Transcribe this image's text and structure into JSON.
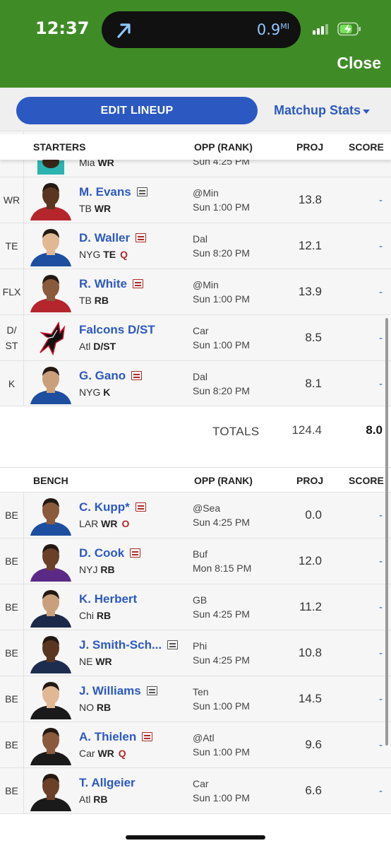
{
  "status_bar": {
    "time": "12:37",
    "distance": "0.9",
    "distance_unit": "MI"
  },
  "header": {
    "close_label": "Close"
  },
  "toolbar": {
    "edit_lineup_label": "EDIT LINEUP",
    "matchup_label": "Matchup Stats"
  },
  "columns": {
    "opp": "OPP (RANK)",
    "proj": "PROJ",
    "score": "SCORE"
  },
  "starters": {
    "title": "STARTERS",
    "partial_row": {
      "team": "Mia",
      "pos": "WR",
      "opp2": "Sun 4:25 PM"
    },
    "rows": [
      {
        "slot": "WR",
        "name": "M. Evans",
        "team": "TB",
        "pos": "WR",
        "status": "",
        "news": "gray",
        "opp": "@Min",
        "time": "Sun 1:00 PM",
        "proj": "13.8",
        "score": "-",
        "avatar": "player-buccaneers"
      },
      {
        "slot": "TE",
        "name": "D. Waller",
        "team": "NYG",
        "pos": "TE",
        "status": "Q",
        "news": "red",
        "opp": "Dal",
        "time": "Sun 8:20 PM",
        "proj": "12.1",
        "score": "-",
        "avatar": "player-giants"
      },
      {
        "slot": "FLX",
        "name": "R. White",
        "team": "TB",
        "pos": "RB",
        "status": "",
        "news": "red",
        "opp": "@Min",
        "time": "Sun 1:00 PM",
        "proj": "13.9",
        "score": "-",
        "avatar": "player-buccaneers"
      },
      {
        "slot": "D/\nST",
        "name": "Falcons D/ST",
        "team": "Atl",
        "pos": "D/ST",
        "status": "",
        "news": "",
        "opp": "Car",
        "time": "Sun 1:00 PM",
        "proj": "8.5",
        "score": "-",
        "avatar": "falcons-logo"
      },
      {
        "slot": "K",
        "name": "G. Gano",
        "team": "NYG",
        "pos": "K",
        "status": "",
        "news": "red",
        "opp": "Dal",
        "time": "Sun 8:20 PM",
        "proj": "8.1",
        "score": "-",
        "avatar": "player-giants"
      }
    ],
    "totals": {
      "label": "TOTALS",
      "proj": "124.4",
      "score": "8.0"
    }
  },
  "bench": {
    "title": "BENCH",
    "rows": [
      {
        "slot": "BE",
        "name": "C. Kupp*",
        "team": "LAR",
        "pos": "WR",
        "status": "O",
        "news": "red",
        "opp": "@Sea",
        "time": "Sun 4:25 PM",
        "proj": "0.0",
        "score": "-",
        "avatar": "player-rams"
      },
      {
        "slot": "BE",
        "name": "D. Cook",
        "team": "NYJ",
        "pos": "RB",
        "status": "",
        "news": "red",
        "opp": "Buf",
        "time": "Mon 8:15 PM",
        "proj": "12.0",
        "score": "-",
        "avatar": "player-vikings"
      },
      {
        "slot": "BE",
        "name": "K. Herbert",
        "team": "Chi",
        "pos": "RB",
        "status": "",
        "news": "",
        "opp": "GB",
        "time": "Sun 4:25 PM",
        "proj": "11.2",
        "score": "-",
        "avatar": "player-bears"
      },
      {
        "slot": "BE",
        "name": "J. Smith-Sch...",
        "team": "NE",
        "pos": "WR",
        "status": "",
        "news": "gray",
        "opp": "Phi",
        "time": "Sun 4:25 PM",
        "proj": "10.8",
        "score": "-",
        "avatar": "player-patriots"
      },
      {
        "slot": "BE",
        "name": "J. Williams",
        "team": "NO",
        "pos": "RB",
        "status": "",
        "news": "gray",
        "opp": "Ten",
        "time": "Sun 1:00 PM",
        "proj": "14.5",
        "score": "-",
        "avatar": "player-saints"
      },
      {
        "slot": "BE",
        "name": "A. Thielen",
        "team": "Car",
        "pos": "WR",
        "status": "Q",
        "news": "red",
        "opp": "@Atl",
        "time": "Sun 1:00 PM",
        "proj": "9.6",
        "score": "-",
        "avatar": "player-panthers"
      },
      {
        "slot": "BE",
        "name": "T. Allgeier",
        "team": "Atl",
        "pos": "RB",
        "status": "",
        "news": "",
        "opp": "Car",
        "time": "Sun 1:00 PM",
        "proj": "6.6",
        "score": "-",
        "avatar": "player-falcons"
      }
    ]
  },
  "colors": {
    "header_green": "#3f8c26",
    "accent_blue": "#2c59c1",
    "status_red": "#b22a2a"
  }
}
